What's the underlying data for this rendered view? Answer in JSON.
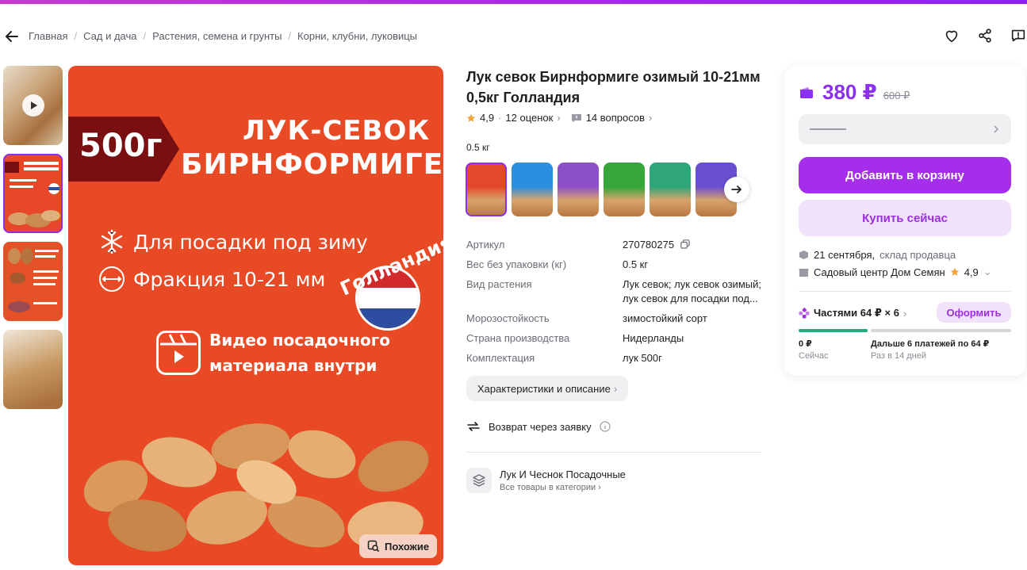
{
  "breadcrumbs": [
    "Главная",
    "Сад и дача",
    "Растения, семена и грунты",
    "Корни, клубни, луковицы"
  ],
  "hero": {
    "weight_badge": "500г",
    "headline1": "ЛУК-СЕВОК",
    "headline2": "БИРНФОРМИГЕ",
    "feature1": "Для посадки под зиму",
    "feature2": "Фракция 10-21 мм",
    "video_line1": "Видео посадочного",
    "video_line2": "материала внутри",
    "country_badge": "Голландия",
    "similar_label": "Похожие"
  },
  "product": {
    "title": "Лук севок Бирнформиге озимый 10-21мм 0,5кг Голландия",
    "rating": "4,9",
    "reviews": "12 оценок",
    "questions": "14 вопросов",
    "weight_option": "0.5 кг",
    "variant_colors": [
      "#e4482b",
      "#2b8fe0",
      "#8d4fc7",
      "#34a63a",
      "#2fa57a",
      "#6a4fd0"
    ]
  },
  "specs": [
    {
      "k": "Артикул",
      "v": "270780275"
    },
    {
      "k": "Вес без упаковки (кг)",
      "v": "0.5 кг"
    },
    {
      "k": "Вид растения",
      "v": "Лук севок; лук севок озимый; лук севок для посадки под..."
    },
    {
      "k": "Морозостойкость",
      "v": "зимостойкий сорт"
    },
    {
      "k": "Страна производства",
      "v": "Нидерланды"
    },
    {
      "k": "Комплектация",
      "v": "лук 500г"
    }
  ],
  "chars_button": "Характеристики и описание",
  "return_text": "Возврат через заявку",
  "category": {
    "name": "Лук И Чеснок Посадочные",
    "all_link": "Все товары в категории"
  },
  "buybox": {
    "price": "380 ₽",
    "old_price": "600 ₽",
    "add_to_cart": "Добавить в корзину",
    "buy_now": "Купить сейчас",
    "delivery_date": "21 сентября,",
    "delivery_from": "склад продавца",
    "seller_name": "Садовый центр Дом Семян",
    "seller_rating": "4,9",
    "installments": "Частями 64 ₽ × 6",
    "installments_button": "Оформить",
    "pay_now_amount": "0 ₽",
    "pay_now_label": "Сейчас",
    "pay_later_amount": "Дальше 6 платежей по 64 ₽",
    "pay_later_label": "Раз в 14 дней"
  },
  "colors": {
    "accent": "#a42eea",
    "price": "#8c2ff0",
    "hero_bg": "#e74a25",
    "progress": "#1fab7a"
  }
}
